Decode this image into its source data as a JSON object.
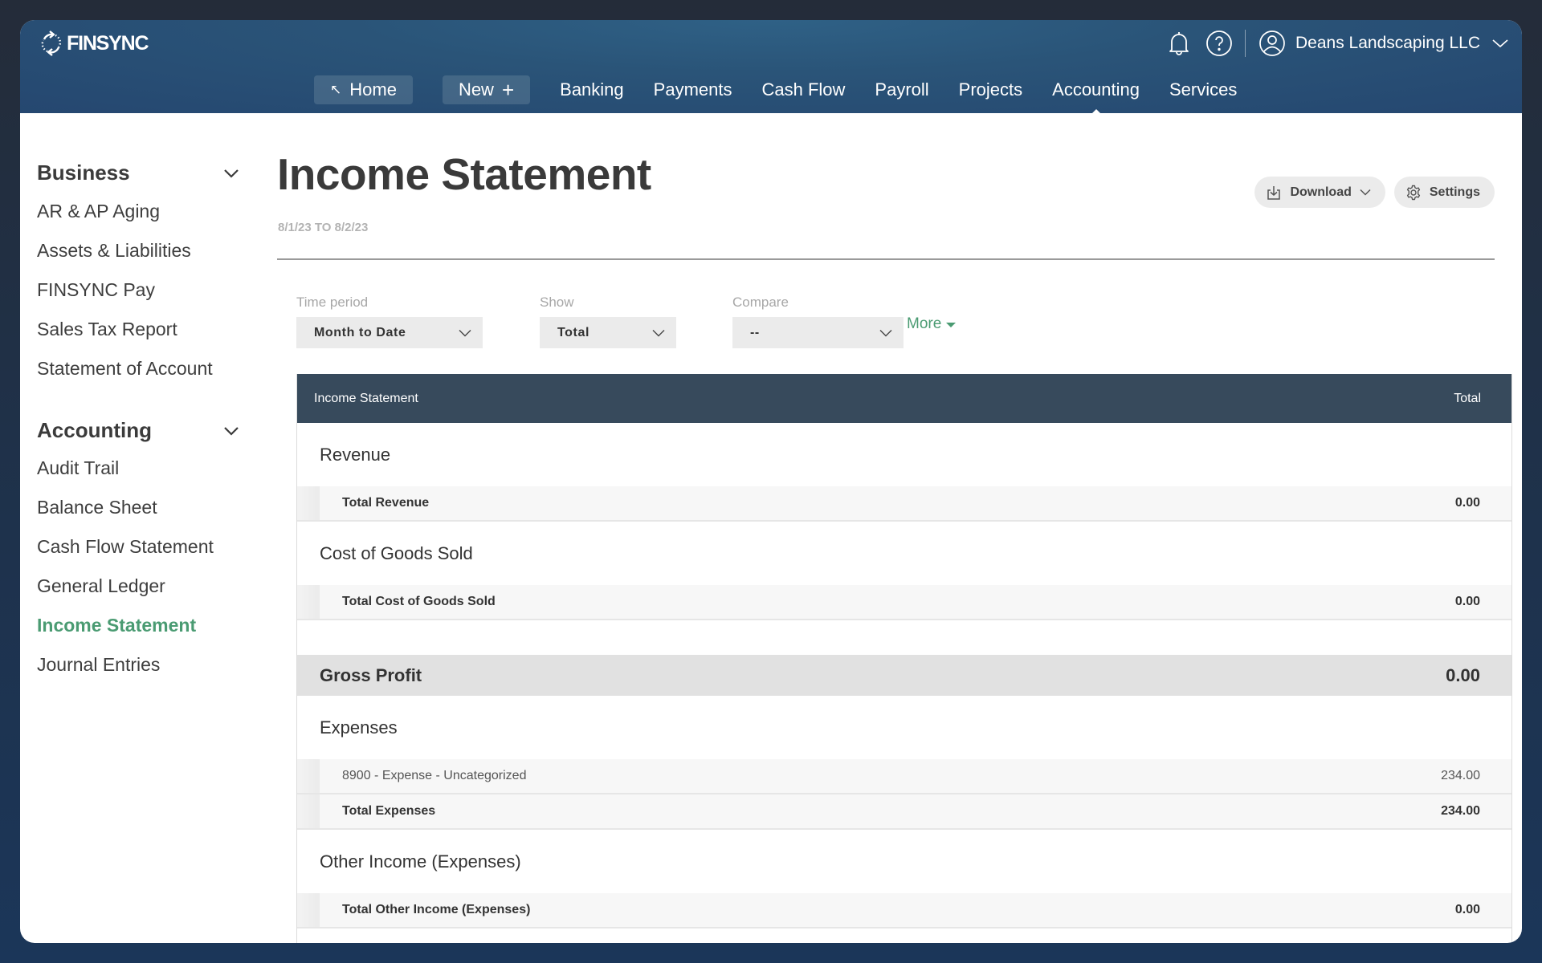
{
  "header": {
    "logo_text": "FINSYNC",
    "account_name": "Deans Landscaping LLC",
    "icons": {
      "notifications": "bell-icon",
      "help": "help-circle-icon",
      "account": "user-circle-icon",
      "account_menu": "chevron-down-icon"
    }
  },
  "nav": {
    "home_label": "Home",
    "home_icon": "↖",
    "new_label": "New",
    "new_icon": "+",
    "links": [
      "Banking",
      "Payments",
      "Cash Flow",
      "Payroll",
      "Projects",
      "Accounting",
      "Services"
    ],
    "active": "Accounting"
  },
  "sidebar": {
    "groups": [
      {
        "title": "Business",
        "items": [
          "AR & AP Aging",
          "Assets & Liabilities",
          "FINSYNC Pay",
          "Sales Tax Report",
          "Statement of Account"
        ]
      },
      {
        "title": "Accounting",
        "items": [
          "Audit Trail",
          "Balance Sheet",
          "Cash Flow Statement",
          "General Ledger",
          "Income Statement",
          "Journal Entries"
        ]
      }
    ],
    "active_item": "Income Statement",
    "active_color": "#4a9b72"
  },
  "page": {
    "title": "Income Statement",
    "date_range": "8/1/23 TO 8/2/23",
    "download_label": "Download",
    "settings_label": "Settings"
  },
  "filters": {
    "time_period": {
      "label": "Time period",
      "value": "Month to Date"
    },
    "show": {
      "label": "Show",
      "value": "Total"
    },
    "compare": {
      "label": "Compare",
      "value": "--"
    },
    "more_label": "More"
  },
  "table": {
    "header": {
      "title": "Income Statement",
      "column": "Total"
    },
    "revenue": {
      "title": "Revenue",
      "total_label": "Total Revenue",
      "total_value": "0.00"
    },
    "cogs": {
      "title": "Cost of Goods Sold",
      "total_label": "Total Cost of Goods Sold",
      "total_value": "0.00"
    },
    "gross_profit": {
      "label": "Gross Profit",
      "value": "0.00"
    },
    "expenses": {
      "title": "Expenses",
      "lines": [
        {
          "label": "8900 - Expense - Uncategorized",
          "value": "234.00"
        }
      ],
      "total_label": "Total Expenses",
      "total_value": "234.00"
    },
    "other": {
      "title": "Other Income (Expenses)",
      "total_label": "Total Other Income (Expenses)",
      "total_value": "0.00"
    }
  }
}
